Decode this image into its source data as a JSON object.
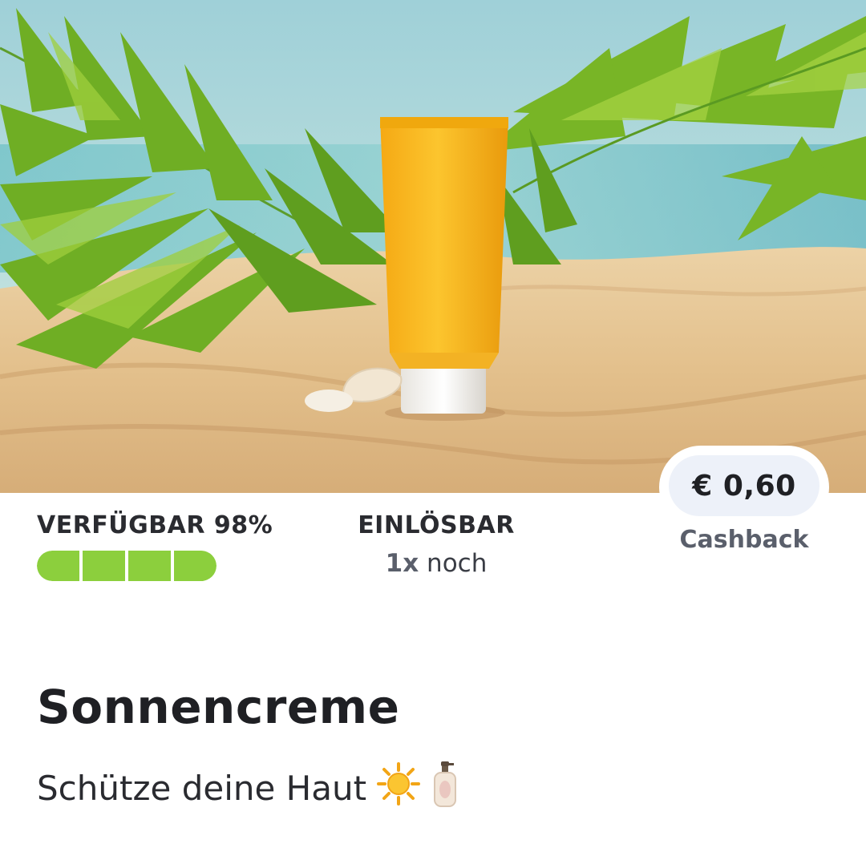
{
  "offer": {
    "image_alt": "Gelbe Sonnencreme-Tube im Sand unter Palmblättern",
    "price": "€ 0,60",
    "cashback_label": "Cashback",
    "availability_label": "VERFÜGBAR 98%",
    "availability_percent": 98,
    "availability_segments": 4,
    "redeemable_label": "EINLÖSBAR",
    "redeemable_count": "1x",
    "redeemable_suffix": " noch",
    "title": "Sonnencreme",
    "subtitle": "Schütze deine Haut",
    "subtitle_icons": [
      "sun-icon",
      "lotion-bottle-icon"
    ]
  },
  "colors": {
    "progress": "#8ccf3d",
    "price_pill": "#edf1f9",
    "tube": "#f7b81c"
  }
}
